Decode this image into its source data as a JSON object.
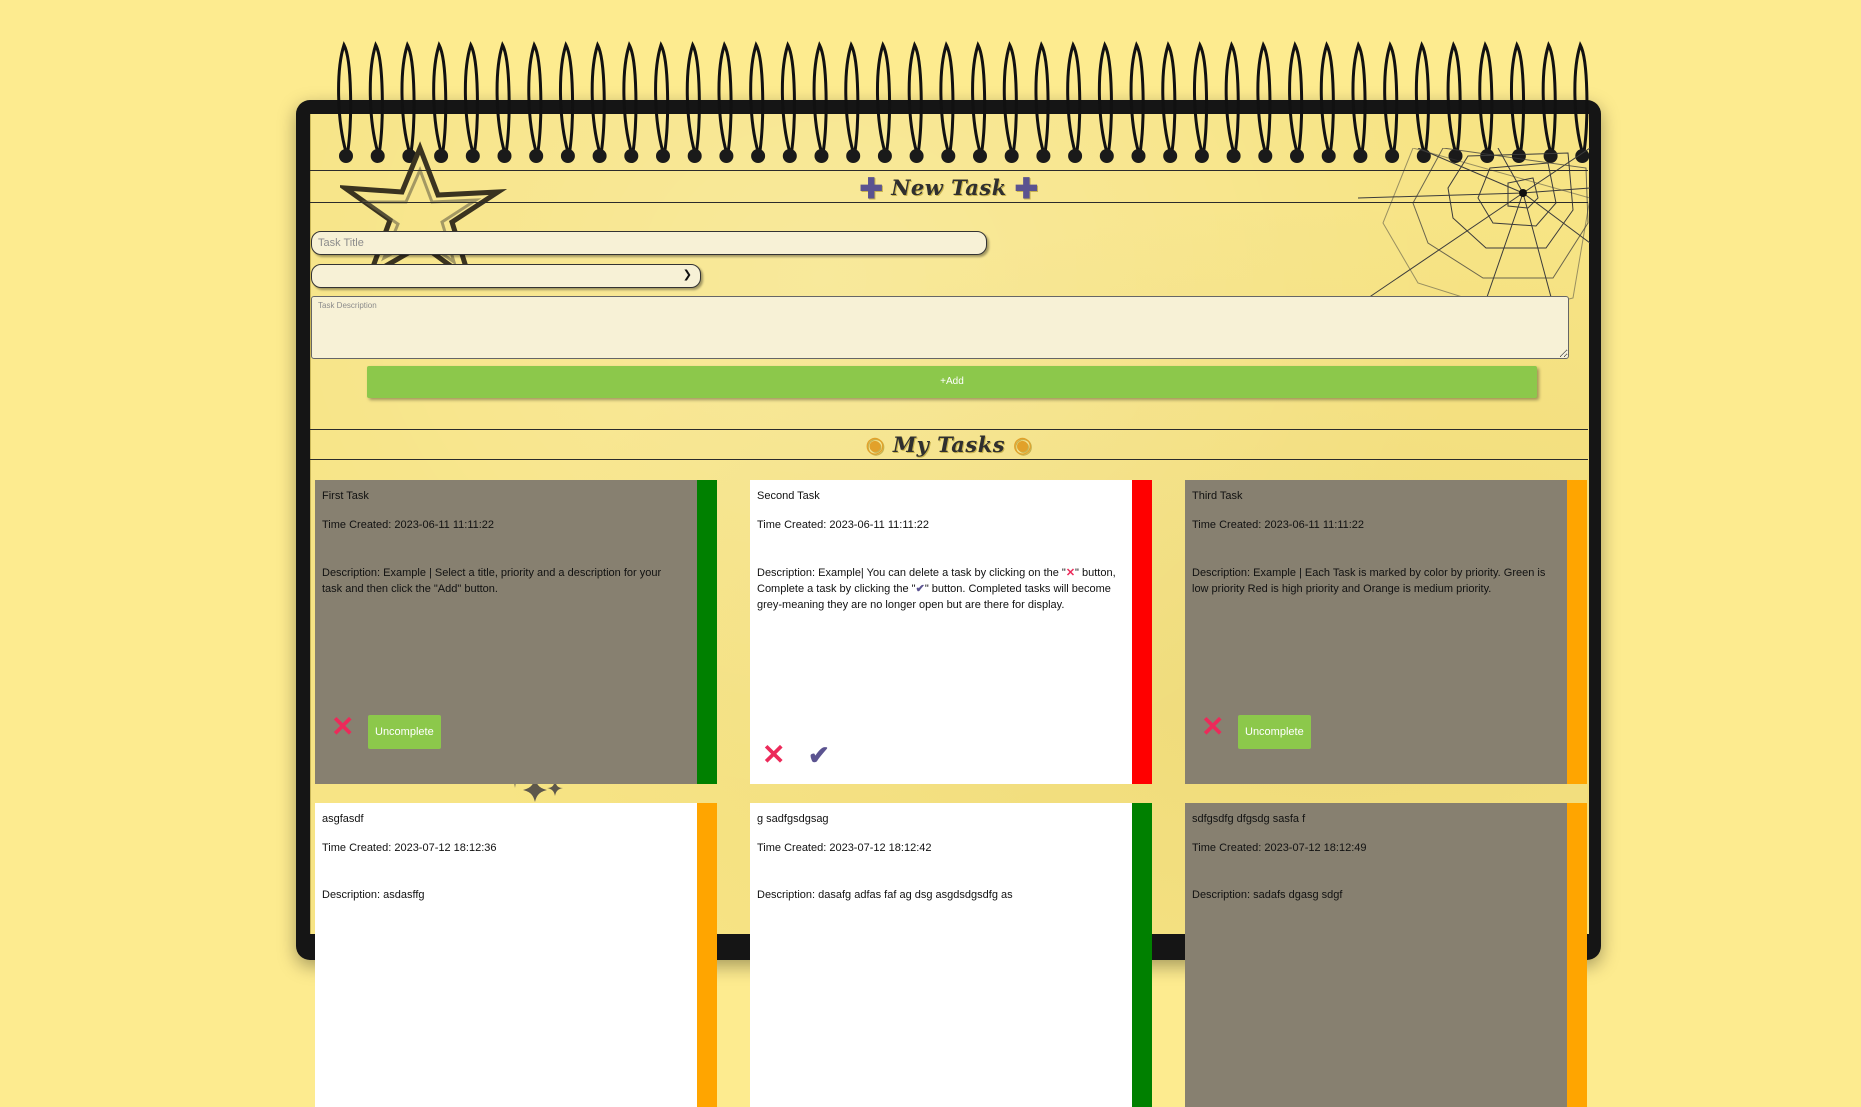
{
  "new_task": {
    "heading": "New Task",
    "heading_icon_left": "plus-icon",
    "heading_icon_right": "plus-icon",
    "title_placeholder": "Task Title",
    "priority_selected": "",
    "description_placeholder": "Task Description",
    "add_label": "+Add"
  },
  "my_tasks": {
    "heading": "My Tasks",
    "heading_icon": "money-bag-icon"
  },
  "colors": {
    "low": "#008000",
    "high": "#ff0000",
    "medium": "#ffa500",
    "completed_card": "#878070",
    "open_card": "#ffffff",
    "accent_green": "#8cc84b",
    "delete_red": "#ec2a5a",
    "check_purple": "#5b5390"
  },
  "tasks": [
    {
      "title": "First Task",
      "time": "Time Created: 2023-06-11 11:11:22",
      "description": "Description: Example | Select a title, priority and a description for your task and then click the \"Add\" button.",
      "priority": "low",
      "completed": true,
      "action_label": "Uncomplete"
    },
    {
      "title": "Second Task",
      "time": "Time Created: 2023-06-11 11:11:22",
      "desc_part1": "Description: Example| You can delete a task by clicking on the \"",
      "desc_part2": "\" button, Complete a task by clicking the \"",
      "desc_part3": "\" button. Completed tasks will become grey-meaning they are no longer open but are there for display.",
      "priority": "high",
      "completed": false
    },
    {
      "title": "Third Task",
      "time": "Time Created: 2023-06-11 11:11:22",
      "description": "Description: Example | Each Task is marked by color by priority. Green is low priority Red is high priority and Orange is medium priority.",
      "priority": "medium",
      "completed": true,
      "action_label": "Uncomplete"
    },
    {
      "title": "asgfasdf",
      "time": "Time Created: 2023-07-12 18:12:36",
      "description": "Description: asdasffg",
      "priority": "medium",
      "completed": false
    },
    {
      "title": "g sadfgsdgsag",
      "time": "Time Created: 2023-07-12 18:12:42",
      "description": "Description: dasafg adfas faf ag dsg asgdsdgsdfg as",
      "priority": "low",
      "completed": false
    },
    {
      "title": "sdfgsdfg dfgsdg sasfa f",
      "time": "Time Created: 2023-07-12 18:12:49",
      "description": "Description: sadafs dgasg sdgf",
      "priority": "medium",
      "completed": true
    }
  ]
}
